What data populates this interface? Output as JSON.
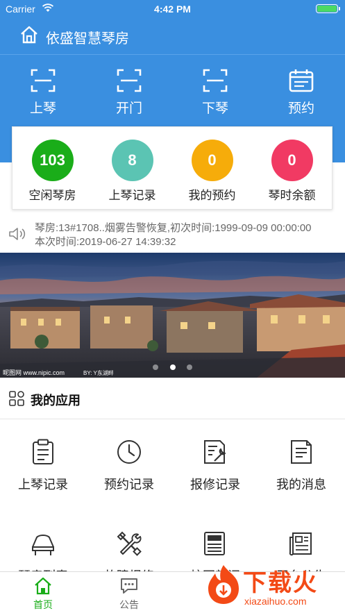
{
  "status_bar": {
    "carrier": "Carrier",
    "time": "4:42 PM"
  },
  "header": {
    "title": "依盛智慧琴房"
  },
  "actions": [
    {
      "label": "上琴",
      "icon": "scan-icon"
    },
    {
      "label": "开门",
      "icon": "scan-icon"
    },
    {
      "label": "下琴",
      "icon": "scan-icon"
    },
    {
      "label": "预约",
      "icon": "calendar-icon"
    }
  ],
  "stats": [
    {
      "value": "103",
      "label": "空闲琴房",
      "color": "#1aad19"
    },
    {
      "value": "8",
      "label": "上琴记录",
      "color": "#5bc4b3"
    },
    {
      "value": "0",
      "label": "我的预约",
      "color": "#f6ac0a"
    },
    {
      "value": "0",
      "label": "琴时余额",
      "color": "#f13a63"
    }
  ],
  "notice": {
    "text": "琴房:13#1708..烟雾告警恢复,初次时间:1999-09-09 00:00:00本次时间:2019-06-27 14:39:32"
  },
  "banner": {
    "caption_left": "昵图网 www.nipic.com",
    "caption_mid": "BY: Y东湖畔",
    "dots": 3,
    "active_dot": 2
  },
  "apps_section": {
    "title": "我的应用"
  },
  "apps": [
    {
      "label": "上琴记录",
      "icon": "clipboard-icon"
    },
    {
      "label": "预约记录",
      "icon": "clock-icon"
    },
    {
      "label": "报修记录",
      "icon": "repair-document-icon"
    },
    {
      "label": "我的消息",
      "icon": "message-document-icon"
    },
    {
      "label": "琴房列表",
      "icon": "piano-icon"
    },
    {
      "label": "故障报修",
      "icon": "tools-icon"
    },
    {
      "label": "校园新闻",
      "icon": "newspaper-icon"
    },
    {
      "label": "平台公告",
      "icon": "notice-paper-icon"
    }
  ],
  "tabs": [
    {
      "label": "首页",
      "icon": "home-icon",
      "active": true
    },
    {
      "label": "公告",
      "icon": "chat-icon",
      "active": false
    }
  ],
  "watermark": {
    "brand": "下载火",
    "url": "xiazaihuo.com"
  },
  "colors": {
    "primary": "#3a8fe0",
    "active_tab": "#1aad19"
  }
}
